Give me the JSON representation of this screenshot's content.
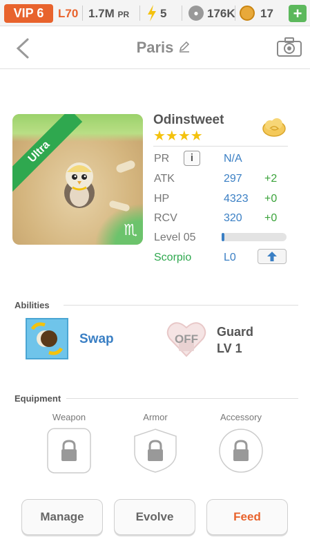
{
  "status_bar": {
    "vip": "VIP 6",
    "level": "L70",
    "pr_value": "1.7M",
    "pr_unit": "PR",
    "energy": "5",
    "paw": "176K",
    "coins": "17",
    "plus": "+"
  },
  "header": {
    "title": "Paris"
  },
  "pet": {
    "rarity": "Ultra",
    "name": "Odinstweet",
    "stars": "★★★★",
    "zodiac_glyph": "♏",
    "stats": {
      "pr_label": "PR",
      "info": "i",
      "pr_value": "N/A",
      "atk_label": "ATK",
      "atk_value": "297",
      "atk_bonus": "+2",
      "hp_label": "HP",
      "hp_value": "4323",
      "hp_bonus": "+0",
      "rcv_label": "RCV",
      "rcv_value": "320",
      "rcv_bonus": "+0",
      "level_label": "Level 05",
      "level_progress": 0.04,
      "zodiac_label": "Scorpio",
      "zodiac_level": "L0"
    }
  },
  "abilities": {
    "title": "Abilities",
    "active": {
      "name": "Swap"
    },
    "passive": {
      "state": "OFF",
      "name": "Guard",
      "level": "LV 1"
    }
  },
  "equipment": {
    "title": "Equipment",
    "slots": [
      "Weapon",
      "Armor",
      "Accessory"
    ]
  },
  "actions": {
    "manage": "Manage",
    "evolve": "Evolve",
    "feed": "Feed"
  },
  "colors": {
    "accent_orange": "#e8632d",
    "stat_blue": "#3a7fc4",
    "bonus_green": "#3aa33a",
    "rarity_green": "#2fa84f"
  }
}
